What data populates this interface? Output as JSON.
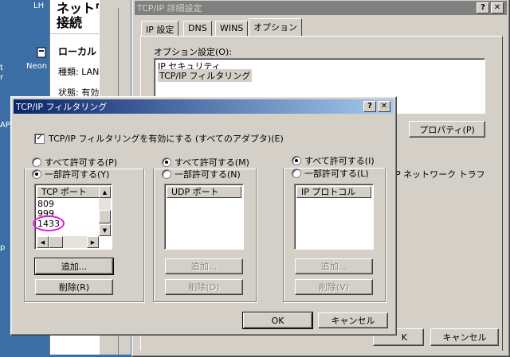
{
  "desktop": {
    "icon_labels": [
      "LH",
      "Neon",
      "t",
      "r",
      "APT",
      "p"
    ]
  },
  "bg_window": {
    "title_lines": [
      "ネットワ",
      "接続"
    ],
    "section": "ローカル",
    "type_label": "種類: LAN",
    "status_label": "状態: 有効"
  },
  "adv_dialog": {
    "title": "TCP/IP 詳細設定",
    "tabs": [
      "IP 設定",
      "DNS",
      "WINS",
      "オプション"
    ],
    "options_label": "オプション設定(O):",
    "options": [
      "IP セキュリティ",
      "TCP/IP フィルタリング"
    ],
    "properties_button": "プロパティ(P)",
    "description_fragment": "P ネットワーク トラフ",
    "ok_fragment": "K",
    "cancel_button": "キャンセル"
  },
  "filter_dialog": {
    "title": "TCP/IP フィルタリング",
    "enable_checkbox_label": "TCP/IP フィルタリングを有効にする (すべてのアダプタ)(E)",
    "enable_checked": true,
    "tcp": {
      "permit_all": "すべて許可する(P)",
      "permit_only": "一部許可する(Y)",
      "selected": "permit_only",
      "list_header": "TCP ポート",
      "ports": [
        "809",
        "999",
        "1433"
      ],
      "highlighted_port": "1433",
      "add_button": "追加...",
      "remove_button": "削除(R)"
    },
    "udp": {
      "permit_all": "すべて許可する(M)",
      "permit_only": "一部許可する(N)",
      "selected": "permit_all",
      "list_header": "UDP ポート",
      "add_button": "追加...",
      "remove_button": "削除(O)"
    },
    "ip": {
      "permit_all": "すべて許可する(I)",
      "permit_only": "一部許可する(L)",
      "selected": "permit_all",
      "list_header": "IP プロトコル",
      "add_button": "追加...",
      "remove_button": "削除(V)"
    },
    "ok_button": "OK",
    "cancel_button": "キャンセル",
    "help_glyph": "?",
    "close_glyph": "✕"
  },
  "colors": {
    "desktop": "#3a6ea5",
    "highlight_circle": "#e020e0",
    "active_title_start": "#0a246a",
    "active_title_end": "#a6caf0"
  }
}
